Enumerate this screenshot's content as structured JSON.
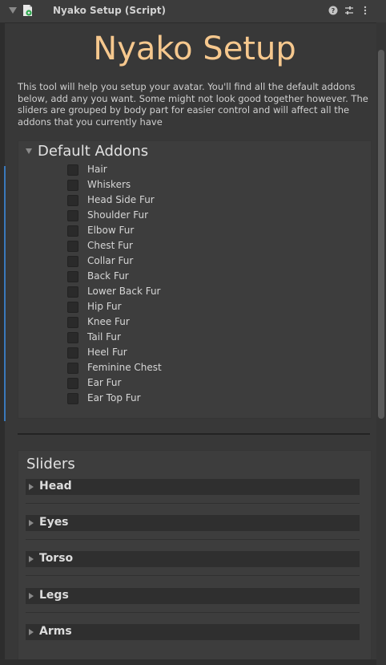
{
  "header": {
    "title": "Nyako Setup (Script)",
    "icons": [
      "help-icon",
      "preset-icon",
      "kebab-menu-icon"
    ]
  },
  "main": {
    "title": "Nyako Setup",
    "description": "This tool will help you setup your avatar. You'll find all the default addons below, add any you want. Some might not look good together however. The sliders are grouped by body part for easier control and will affect all the addons that you currently have"
  },
  "default_addons": {
    "title": "Default Addons",
    "items": [
      {
        "label": "Hair",
        "checked": false
      },
      {
        "label": "Whiskers",
        "checked": false
      },
      {
        "label": "Head Side Fur",
        "checked": false
      },
      {
        "label": "Shoulder Fur",
        "checked": false
      },
      {
        "label": "Elbow Fur",
        "checked": false
      },
      {
        "label": "Chest Fur",
        "checked": false
      },
      {
        "label": "Collar Fur",
        "checked": false
      },
      {
        "label": "Back Fur",
        "checked": false
      },
      {
        "label": "Lower Back Fur",
        "checked": false
      },
      {
        "label": "Hip Fur",
        "checked": false
      },
      {
        "label": "Knee Fur",
        "checked": false
      },
      {
        "label": "Tail Fur",
        "checked": false
      },
      {
        "label": "Heel Fur",
        "checked": false
      },
      {
        "label": "Feminine Chest",
        "checked": false
      },
      {
        "label": "Ear Fur",
        "checked": false
      },
      {
        "label": "Ear Top Fur",
        "checked": false
      }
    ]
  },
  "sliders": {
    "title": "Sliders",
    "groups": [
      {
        "label": "Head"
      },
      {
        "label": "Eyes"
      },
      {
        "label": "Torso"
      },
      {
        "label": "Legs"
      },
      {
        "label": "Arms"
      }
    ]
  },
  "colors": {
    "title_accent": "#f6c88e",
    "selection_bar": "#3a79bb"
  }
}
